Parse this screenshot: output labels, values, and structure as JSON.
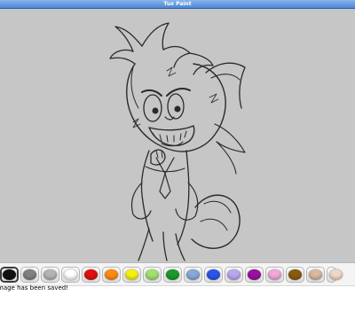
{
  "window": {
    "title": "Tux Paint"
  },
  "palette": {
    "selected_index": 0,
    "colors": [
      {
        "name": "black",
        "hex": "#111111"
      },
      {
        "name": "dark-gray",
        "hex": "#808080"
      },
      {
        "name": "light-gray",
        "hex": "#b4b4b4"
      },
      {
        "name": "white",
        "hex": "#ffffff"
      },
      {
        "name": "red",
        "hex": "#e01010"
      },
      {
        "name": "orange",
        "hex": "#ff8a10"
      },
      {
        "name": "yellow",
        "hex": "#f5f010"
      },
      {
        "name": "light-green",
        "hex": "#a0e070"
      },
      {
        "name": "dark-green",
        "hex": "#1c9a2a"
      },
      {
        "name": "sky-blue",
        "hex": "#88a8d8"
      },
      {
        "name": "blue",
        "hex": "#2a55e8"
      },
      {
        "name": "lavender",
        "hex": "#b8a8f0"
      },
      {
        "name": "purple",
        "hex": "#9a10a0"
      },
      {
        "name": "pink",
        "hex": "#f0a8d8"
      },
      {
        "name": "brown",
        "hex": "#8a5a10"
      },
      {
        "name": "tan",
        "hex": "#d8b8a0"
      },
      {
        "name": "beige",
        "hex": "#f0d8c8"
      }
    ]
  },
  "status": {
    "message": "mage has been saved!"
  }
}
